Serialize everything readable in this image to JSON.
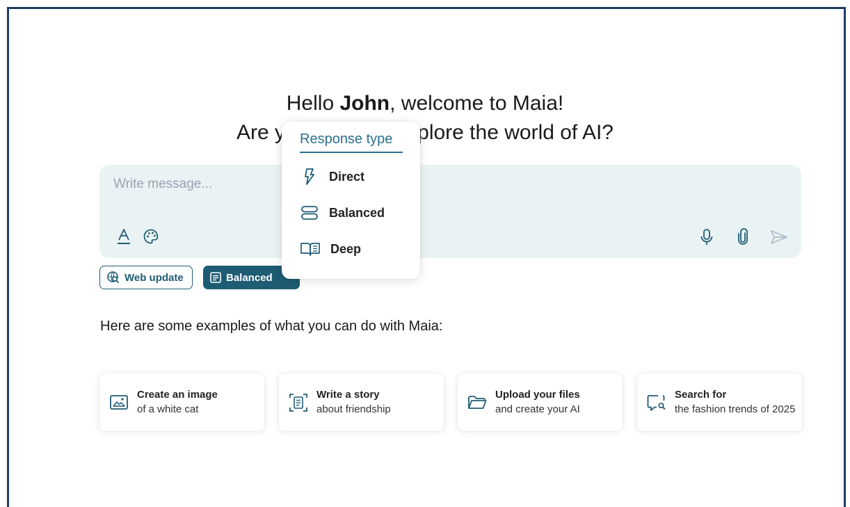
{
  "greeting": {
    "hello": "Hello ",
    "name": "John",
    "welcome": ", welcome to Maia!",
    "line2": "Are you ready to explore the world of AI?"
  },
  "composer": {
    "placeholder": "Write message...",
    "icons": [
      "text-format-icon",
      "palette-icon",
      "microphone-icon",
      "paperclip-icon",
      "send-icon"
    ]
  },
  "chips": {
    "web_update": "Web update",
    "balanced": "Balanced"
  },
  "response_menu": {
    "title": "Response type",
    "options": [
      {
        "label": "Direct",
        "icon": "lightning-icon"
      },
      {
        "label": "Balanced",
        "icon": "balanced-icon"
      },
      {
        "label": "Deep",
        "icon": "book-icon"
      }
    ]
  },
  "examples": {
    "heading": "Here are some examples of what you can do with Maia:",
    "cards": [
      {
        "title": "Create an image",
        "subtitle": "of a white cat",
        "icon": "image-icon"
      },
      {
        "title": "Write a story",
        "subtitle": "about friendship",
        "icon": "document-scan-icon"
      },
      {
        "title": "Upload your files",
        "subtitle": "and create your AI",
        "icon": "folder-icon"
      },
      {
        "title": "Search for",
        "subtitle": "the fashion trends of 2025",
        "icon": "search-chat-icon"
      }
    ]
  },
  "colors": {
    "accent": "#1e5c74",
    "composer_bg": "#eaf3f4",
    "frame_border": "#1f3b63",
    "menu_title": "#2a6f8f"
  }
}
